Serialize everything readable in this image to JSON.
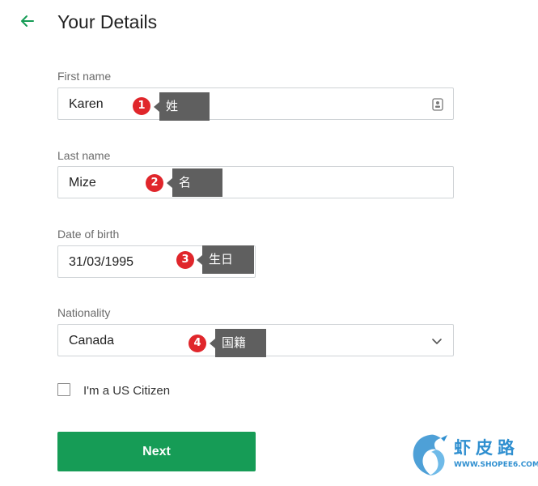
{
  "header": {
    "title": "Your Details",
    "back_icon": "arrow-left-icon"
  },
  "form": {
    "first_name": {
      "label": "First name",
      "value": "Karen",
      "icon": "contact-card-icon"
    },
    "last_name": {
      "label": "Last name",
      "value": "Mize"
    },
    "date_of_birth": {
      "label": "Date of birth",
      "value": "31/03/1995"
    },
    "nationality": {
      "label": "Nationality",
      "value": "Canada",
      "icon": "chevron-down-icon"
    },
    "us_citizen": {
      "label": "I'm a US Citizen",
      "checked": false
    },
    "submit_label": "Next"
  },
  "annotations": [
    {
      "number": "1",
      "text": "姓"
    },
    {
      "number": "2",
      "text": "名"
    },
    {
      "number": "3",
      "text": "生日"
    },
    {
      "number": "4",
      "text": "国籍"
    }
  ],
  "watermark": {
    "text": "虾皮路",
    "url": "WWW.SHOPEE6.COM"
  },
  "colors": {
    "accent": "#169c56",
    "marker": "#e0262b",
    "note_bg": "#5f5f5f",
    "watermark": "#2f8fd0"
  }
}
